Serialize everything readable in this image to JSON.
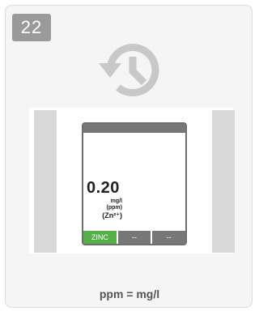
{
  "step": {
    "number": "22"
  },
  "icons": {
    "history": "history-icon"
  },
  "device": {
    "reading": "0.20",
    "unit_lines": [
      "mg/l",
      "(ppm)",
      "(Zn²⁺)"
    ],
    "softkeys": [
      {
        "label": "ZINC",
        "active": true
      },
      {
        "label": "--",
        "active": false
      },
      {
        "label": "--",
        "active": false
      }
    ]
  },
  "caption": "ppm = mg/l",
  "colors": {
    "badge": "#9a9a9a",
    "icon": "#c8c8c8",
    "active_key": "#55b04a",
    "inactive_key": "#777777"
  }
}
